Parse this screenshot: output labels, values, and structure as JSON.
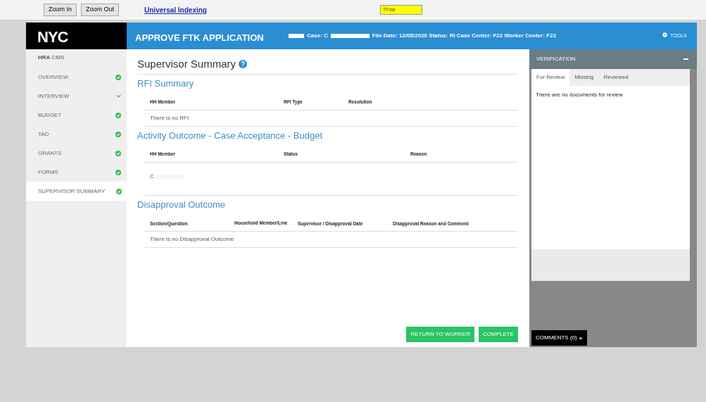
{
  "toolbar": {
    "buttons": [
      "Zoom In",
      "Zoom Out"
    ],
    "link": "Universal Indexing",
    "highlight": "??:nn"
  },
  "header": {
    "logo": "NYC",
    "title": "APPROVE FTK APPLICATION",
    "case_label": "Case: C",
    "file_info": "File Date: 12/05/2020 Status: RI Case Center: F22 Worker Center: F22",
    "tools": "TOOLS"
  },
  "sidebar": {
    "brand_bold": "HRA",
    "brand": "CMS",
    "items": [
      {
        "label": "OVERVIEW",
        "kind": "complete",
        "selected": false
      },
      {
        "label": "INTERVIEW",
        "kind": "expand",
        "selected": false
      },
      {
        "label": "BUDGET",
        "kind": "complete",
        "selected": false
      },
      {
        "label": "TAD",
        "kind": "complete",
        "selected": false
      },
      {
        "label": "GRANTS",
        "kind": "complete",
        "selected": false
      },
      {
        "label": "FORMS",
        "kind": "complete",
        "selected": false
      },
      {
        "label": "SUPERVISOR SUMMARY",
        "kind": "complete",
        "selected": true
      }
    ]
  },
  "main": {
    "title": "Supervisor Summary",
    "sections": [
      {
        "title": "RFI Summary",
        "columns": [
          "HH Member",
          "RFI Type",
          "Resolution"
        ],
        "empty": "There is no RFI"
      },
      {
        "title": "Activity Outcome - Case Acceptance - Budget",
        "columns": [
          "HH Member",
          "Status",
          "Reason"
        ],
        "row_text": "C"
      },
      {
        "title": "Disapproval Outcome",
        "columns": [
          "Section/Question",
          "Household Member/Line",
          "Supervisor / Disapproval Date",
          "Disapproval Reason and Comment"
        ],
        "empty": "There is no Disapproval Outcome"
      }
    ],
    "buttons": [
      "RETURN TO WORKER",
      "COMPLETE"
    ]
  },
  "verification": {
    "title": "VERIFICATION",
    "tabs": [
      {
        "label": "For Review",
        "selected": true
      },
      {
        "label": "Missing",
        "selected": false
      },
      {
        "label": "Reviewed",
        "selected": false
      }
    ],
    "message": "There are no documents for review",
    "comments": "COMMENTS (0)"
  }
}
